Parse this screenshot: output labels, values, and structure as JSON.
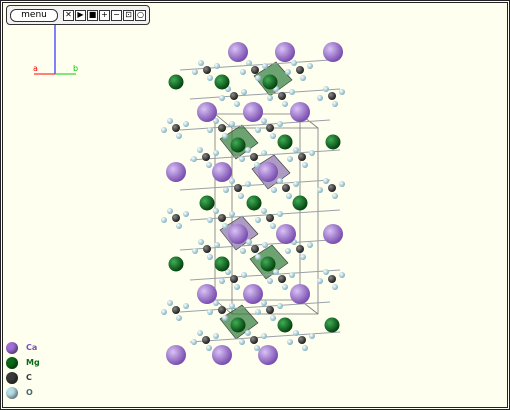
{
  "toolbar": {
    "menu_label": "menu",
    "buttons": [
      {
        "name": "close",
        "glyph": "✕"
      },
      {
        "name": "play",
        "glyph": "▶"
      },
      {
        "name": "stop",
        "glyph": "■"
      },
      {
        "name": "zoom-in",
        "glyph": "+"
      },
      {
        "name": "zoom-out",
        "glyph": "−"
      },
      {
        "name": "reset",
        "glyph": "⊡"
      },
      {
        "name": "orbit",
        "glyph": "○"
      }
    ]
  },
  "axes": {
    "a_label": "a",
    "b_label": "b",
    "a_color": "#ff0000",
    "b_color": "#00cc00",
    "c_color": "#0000ff"
  },
  "legend": [
    {
      "symbol": "Ca",
      "color": "#a070d8",
      "text_color": "#7a4fb0"
    },
    {
      "symbol": "Mg",
      "color": "#0a6a1a",
      "text_color": "#0a6a1a"
    },
    {
      "symbol": "C",
      "color": "#3a3a3a",
      "text_color": "#3a3a3a"
    },
    {
      "symbol": "O",
      "color": "#b8dde6",
      "text_color": "#4a6a72"
    }
  ],
  "colors": {
    "background": "#fffff0",
    "mg_polyhedron": "#2f7a3a",
    "ca_polyhedron": "#8a70b0",
    "bond": "#9aa0a8"
  }
}
